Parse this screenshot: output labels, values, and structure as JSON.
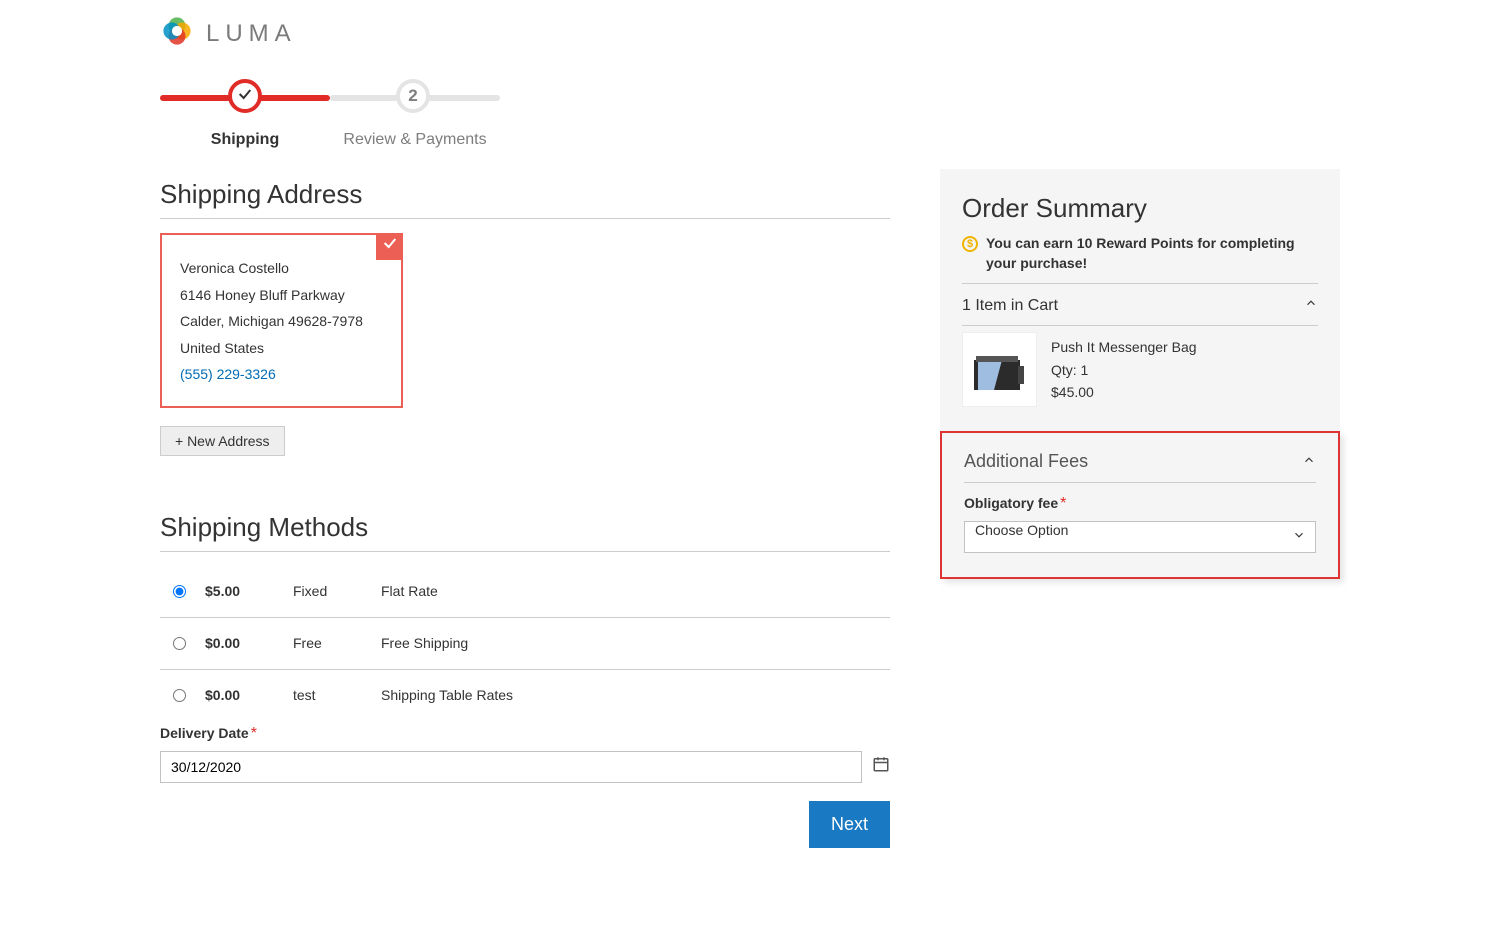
{
  "logo": {
    "text": "LUMA"
  },
  "steps": {
    "step1": "Shipping",
    "step2": "Review & Payments",
    "num2": "2"
  },
  "shipping": {
    "title": "Shipping Address",
    "addr": {
      "name": "Veronica Costello",
      "street": "6146 Honey Bluff Parkway",
      "city": "Calder, Michigan 49628-7978",
      "country": "United States",
      "phone": "(555) 229-3326"
    },
    "new_btn": "+ New Address"
  },
  "methods": {
    "title": "Shipping Methods",
    "rows": [
      {
        "price": "$5.00",
        "carrier": "Fixed",
        "method": "Flat Rate"
      },
      {
        "price": "$0.00",
        "carrier": "Free",
        "method": "Free Shipping"
      },
      {
        "price": "$0.00",
        "carrier": "test",
        "method": "Shipping Table Rates"
      }
    ],
    "delivery_label": "Delivery Date",
    "delivery_value": "30/12/2020",
    "next": "Next"
  },
  "summary": {
    "title": "Order Summary",
    "reward_pre": "You can earn ",
    "reward_bold": "10 Reward Points",
    "reward_post": " for completing your purchase!",
    "cart_head": "1 Item in Cart",
    "item": {
      "name": "Push It Messenger Bag",
      "qty": "Qty: 1",
      "price": "$45.00"
    }
  },
  "fees": {
    "title": "Additional Fees",
    "label": "Obligatory fee",
    "option": "Choose Option"
  }
}
